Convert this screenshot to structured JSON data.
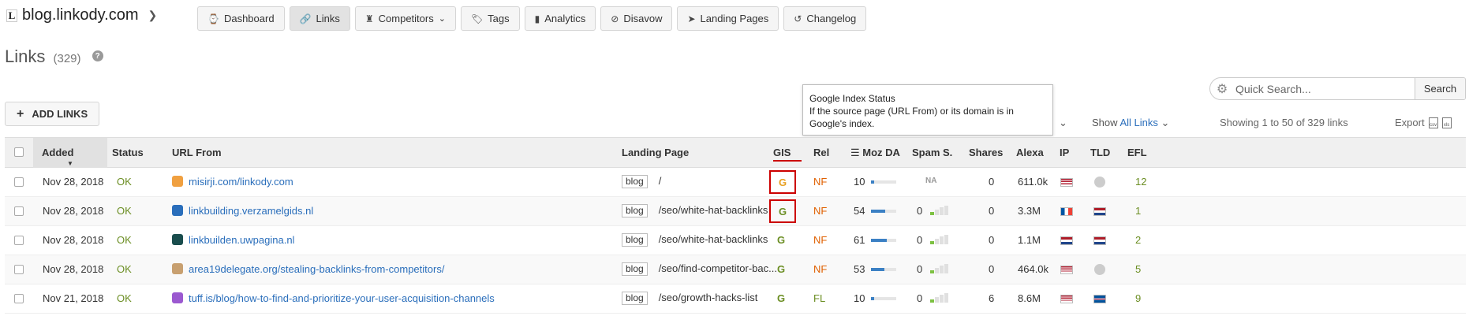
{
  "site": {
    "logo": "L",
    "name": "blog.linkody.com"
  },
  "nav": [
    {
      "label": "Dashboard",
      "icon": "dashboard-icon",
      "glyph": "⌚"
    },
    {
      "label": "Links",
      "icon": "link-icon",
      "glyph": "🔗",
      "active": true
    },
    {
      "label": "Competitors",
      "icon": "chess-icon",
      "glyph": "♜",
      "dropdown": true
    },
    {
      "label": "Tags",
      "icon": "tag-icon",
      "glyph": "🏷"
    },
    {
      "label": "Analytics",
      "icon": "bar-chart-icon",
      "glyph": "▮"
    },
    {
      "label": "Disavow",
      "icon": "ban-icon",
      "glyph": "⊘"
    },
    {
      "label": "Landing Pages",
      "icon": "send-icon",
      "glyph": "➤"
    },
    {
      "label": "Changelog",
      "icon": "history-icon",
      "glyph": "↺"
    }
  ],
  "page": {
    "title": "Links",
    "count": "(329)",
    "help": "?"
  },
  "add_links": {
    "label": "ADD LINKS",
    "plus": "+"
  },
  "search": {
    "placeholder": "Quick Search...",
    "button": "Search"
  },
  "tooltip": {
    "title": "Google Index Status",
    "body": "If the source page (URL From) or its domain is in Google's index."
  },
  "toolbar": {
    "show_prefix": "Show",
    "show_link": "All Links",
    "showing": "Showing 1 to 50 of 329 links",
    "export": "Export"
  },
  "columns": {
    "added": "Added",
    "status": "Status",
    "url_from": "URL From",
    "landing": "Landing Page",
    "gis": "GIS",
    "rel": "Rel",
    "moz": "Moz DA",
    "spam": "Spam S.",
    "shares": "Shares",
    "alexa": "Alexa",
    "ip": "IP",
    "tld": "TLD",
    "efl": "EFL"
  },
  "rows": [
    {
      "added": "Nov 28, 2018",
      "status": "OK",
      "url": "misirji.com/linkody.com",
      "fav": "#f0a040",
      "tag": "blog",
      "landing": "/",
      "gis": "G",
      "gis_color": "#e8a020",
      "gis_boxed": true,
      "rel": "NF",
      "moz": "10",
      "moz_fill": 0.1,
      "spam": "NA",
      "spam_level": 0,
      "shares": "0",
      "alexa": "611.0k",
      "ip": "us",
      "tld": "globe",
      "efl": "12"
    },
    {
      "added": "Nov 28, 2018",
      "status": "OK",
      "url": "linkbuilding.verzamelgids.nl",
      "fav": "#2a6ebb",
      "tag": "blog",
      "landing": "/seo/white-hat-backlinks",
      "gis": "G",
      "gis_color": "#6b8e23",
      "gis_boxed": true,
      "rel": "NF",
      "moz": "54",
      "moz_fill": 0.54,
      "spam": "0",
      "spam_level": 1,
      "shares": "0",
      "alexa": "3.3M",
      "ip": "fr",
      "tld": "nl",
      "efl": "1"
    },
    {
      "added": "Nov 28, 2018",
      "status": "OK",
      "url": "linkbuilden.uwpagina.nl",
      "fav": "#1a4d4d",
      "tag": "blog",
      "landing": "/seo/white-hat-backlinks",
      "gis": "G",
      "gis_color": "#6b8e23",
      "gis_boxed": false,
      "rel": "NF",
      "moz": "61",
      "moz_fill": 0.61,
      "spam": "0",
      "spam_level": 1,
      "shares": "0",
      "alexa": "1.1M",
      "ip": "nl",
      "tld": "nl",
      "efl": "2"
    },
    {
      "added": "Nov 28, 2018",
      "status": "OK",
      "url": "area19delegate.org/stealing-backlinks-from-competitors/",
      "fav": "#c8a070",
      "tag": "blog",
      "landing": "/seo/find-competitor-bac...",
      "gis": "G",
      "gis_color": "#6b8e23",
      "gis_boxed": false,
      "rel": "NF",
      "moz": "53",
      "moz_fill": 0.53,
      "spam": "0",
      "spam_level": 1,
      "shares": "0",
      "alexa": "464.0k",
      "ip": "us",
      "tld": "globe",
      "efl": "5"
    },
    {
      "added": "Nov 21, 2018",
      "status": "OK",
      "url": "tuff.is/blog/how-to-find-and-prioritize-your-user-acquisition-channels",
      "fav": "#9b59d0",
      "tag": "blog",
      "landing": "/seo/growth-hacks-list",
      "gis": "G",
      "gis_color": "#6b8e23",
      "gis_boxed": false,
      "rel": "FL",
      "moz": "10",
      "moz_fill": 0.1,
      "spam": "0",
      "spam_level": 1,
      "shares": "6",
      "alexa": "8.6M",
      "ip": "us",
      "tld": "is",
      "efl": "9"
    }
  ],
  "colors": {
    "accent": "#2a6ebb",
    "ok": "#6b8e23",
    "nofollow": "#e06000",
    "gis_highlight": "#cc0000"
  }
}
